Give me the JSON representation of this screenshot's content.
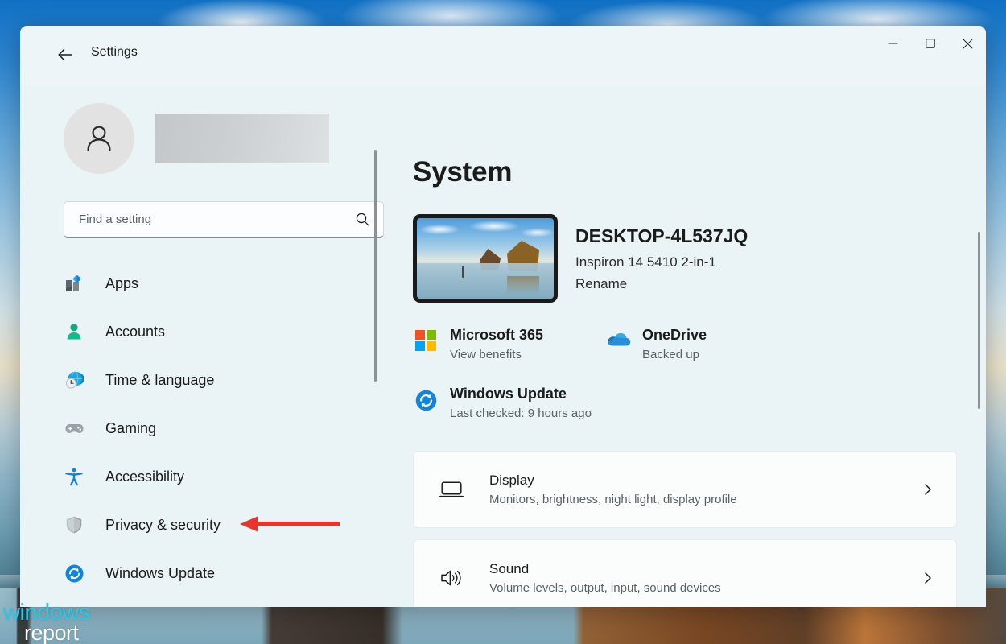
{
  "window": {
    "title": "Settings",
    "back_icon": "arrow-left-icon",
    "controls": {
      "minimize": "minimize-icon",
      "maximize": "maximize-icon",
      "close": "close-icon"
    }
  },
  "sidebar": {
    "avatar_icon": "person-avatar-icon",
    "profile_name": "",
    "search": {
      "placeholder": "Find a setting",
      "value": "",
      "icon": "search-icon"
    },
    "items": [
      {
        "label": "Apps",
        "icon": "apps-icon"
      },
      {
        "label": "Accounts",
        "icon": "accounts-person-icon"
      },
      {
        "label": "Time & language",
        "icon": "clock-globe-icon"
      },
      {
        "label": "Gaming",
        "icon": "gamepad-icon"
      },
      {
        "label": "Accessibility",
        "icon": "accessibility-person-icon"
      },
      {
        "label": "Privacy & security",
        "icon": "shield-icon"
      },
      {
        "label": "Windows Update",
        "icon": "windows-update-icon"
      }
    ]
  },
  "main": {
    "page_title": "System",
    "device": {
      "thumbnail_icon": "device-wallpaper-thumbnail",
      "name": "DESKTOP-4L537JQ",
      "model": "Inspiron 14 5410 2-in-1",
      "rename_label": "Rename"
    },
    "status": [
      {
        "title": "Microsoft 365",
        "subtitle": "View benefits",
        "icon": "microsoft-logo-icon"
      },
      {
        "title": "OneDrive",
        "subtitle": "Backed up",
        "icon": "onedrive-cloud-icon"
      },
      {
        "title": "Windows Update",
        "subtitle": "Last checked: 9 hours ago",
        "icon": "windows-update-icon"
      }
    ],
    "cards": [
      {
        "title": "Display",
        "subtitle": "Monitors, brightness, night light, display profile",
        "icon": "monitor-icon",
        "chevron": "chevron-right-icon"
      },
      {
        "title": "Sound",
        "subtitle": "Volume levels, output, input, sound devices",
        "icon": "speaker-icon",
        "chevron": "chevron-right-icon"
      }
    ]
  },
  "annotation": {
    "arrow_icon": "red-arrow-left-icon",
    "color": "#e8352b",
    "points_to": "Privacy & security"
  },
  "watermark": {
    "line1": "windows",
    "line2": "report",
    "color1": "#29c8e8",
    "color2": "#ffffff"
  },
  "colors": {
    "window_bg": "#eaf3f6",
    "titlebar_bg": "#eef5f8",
    "card_bg": "#fbfdfd",
    "text_primary": "#1b1b1b",
    "text_secondary": "#5a6266",
    "accent_blue": "#0078d4"
  }
}
